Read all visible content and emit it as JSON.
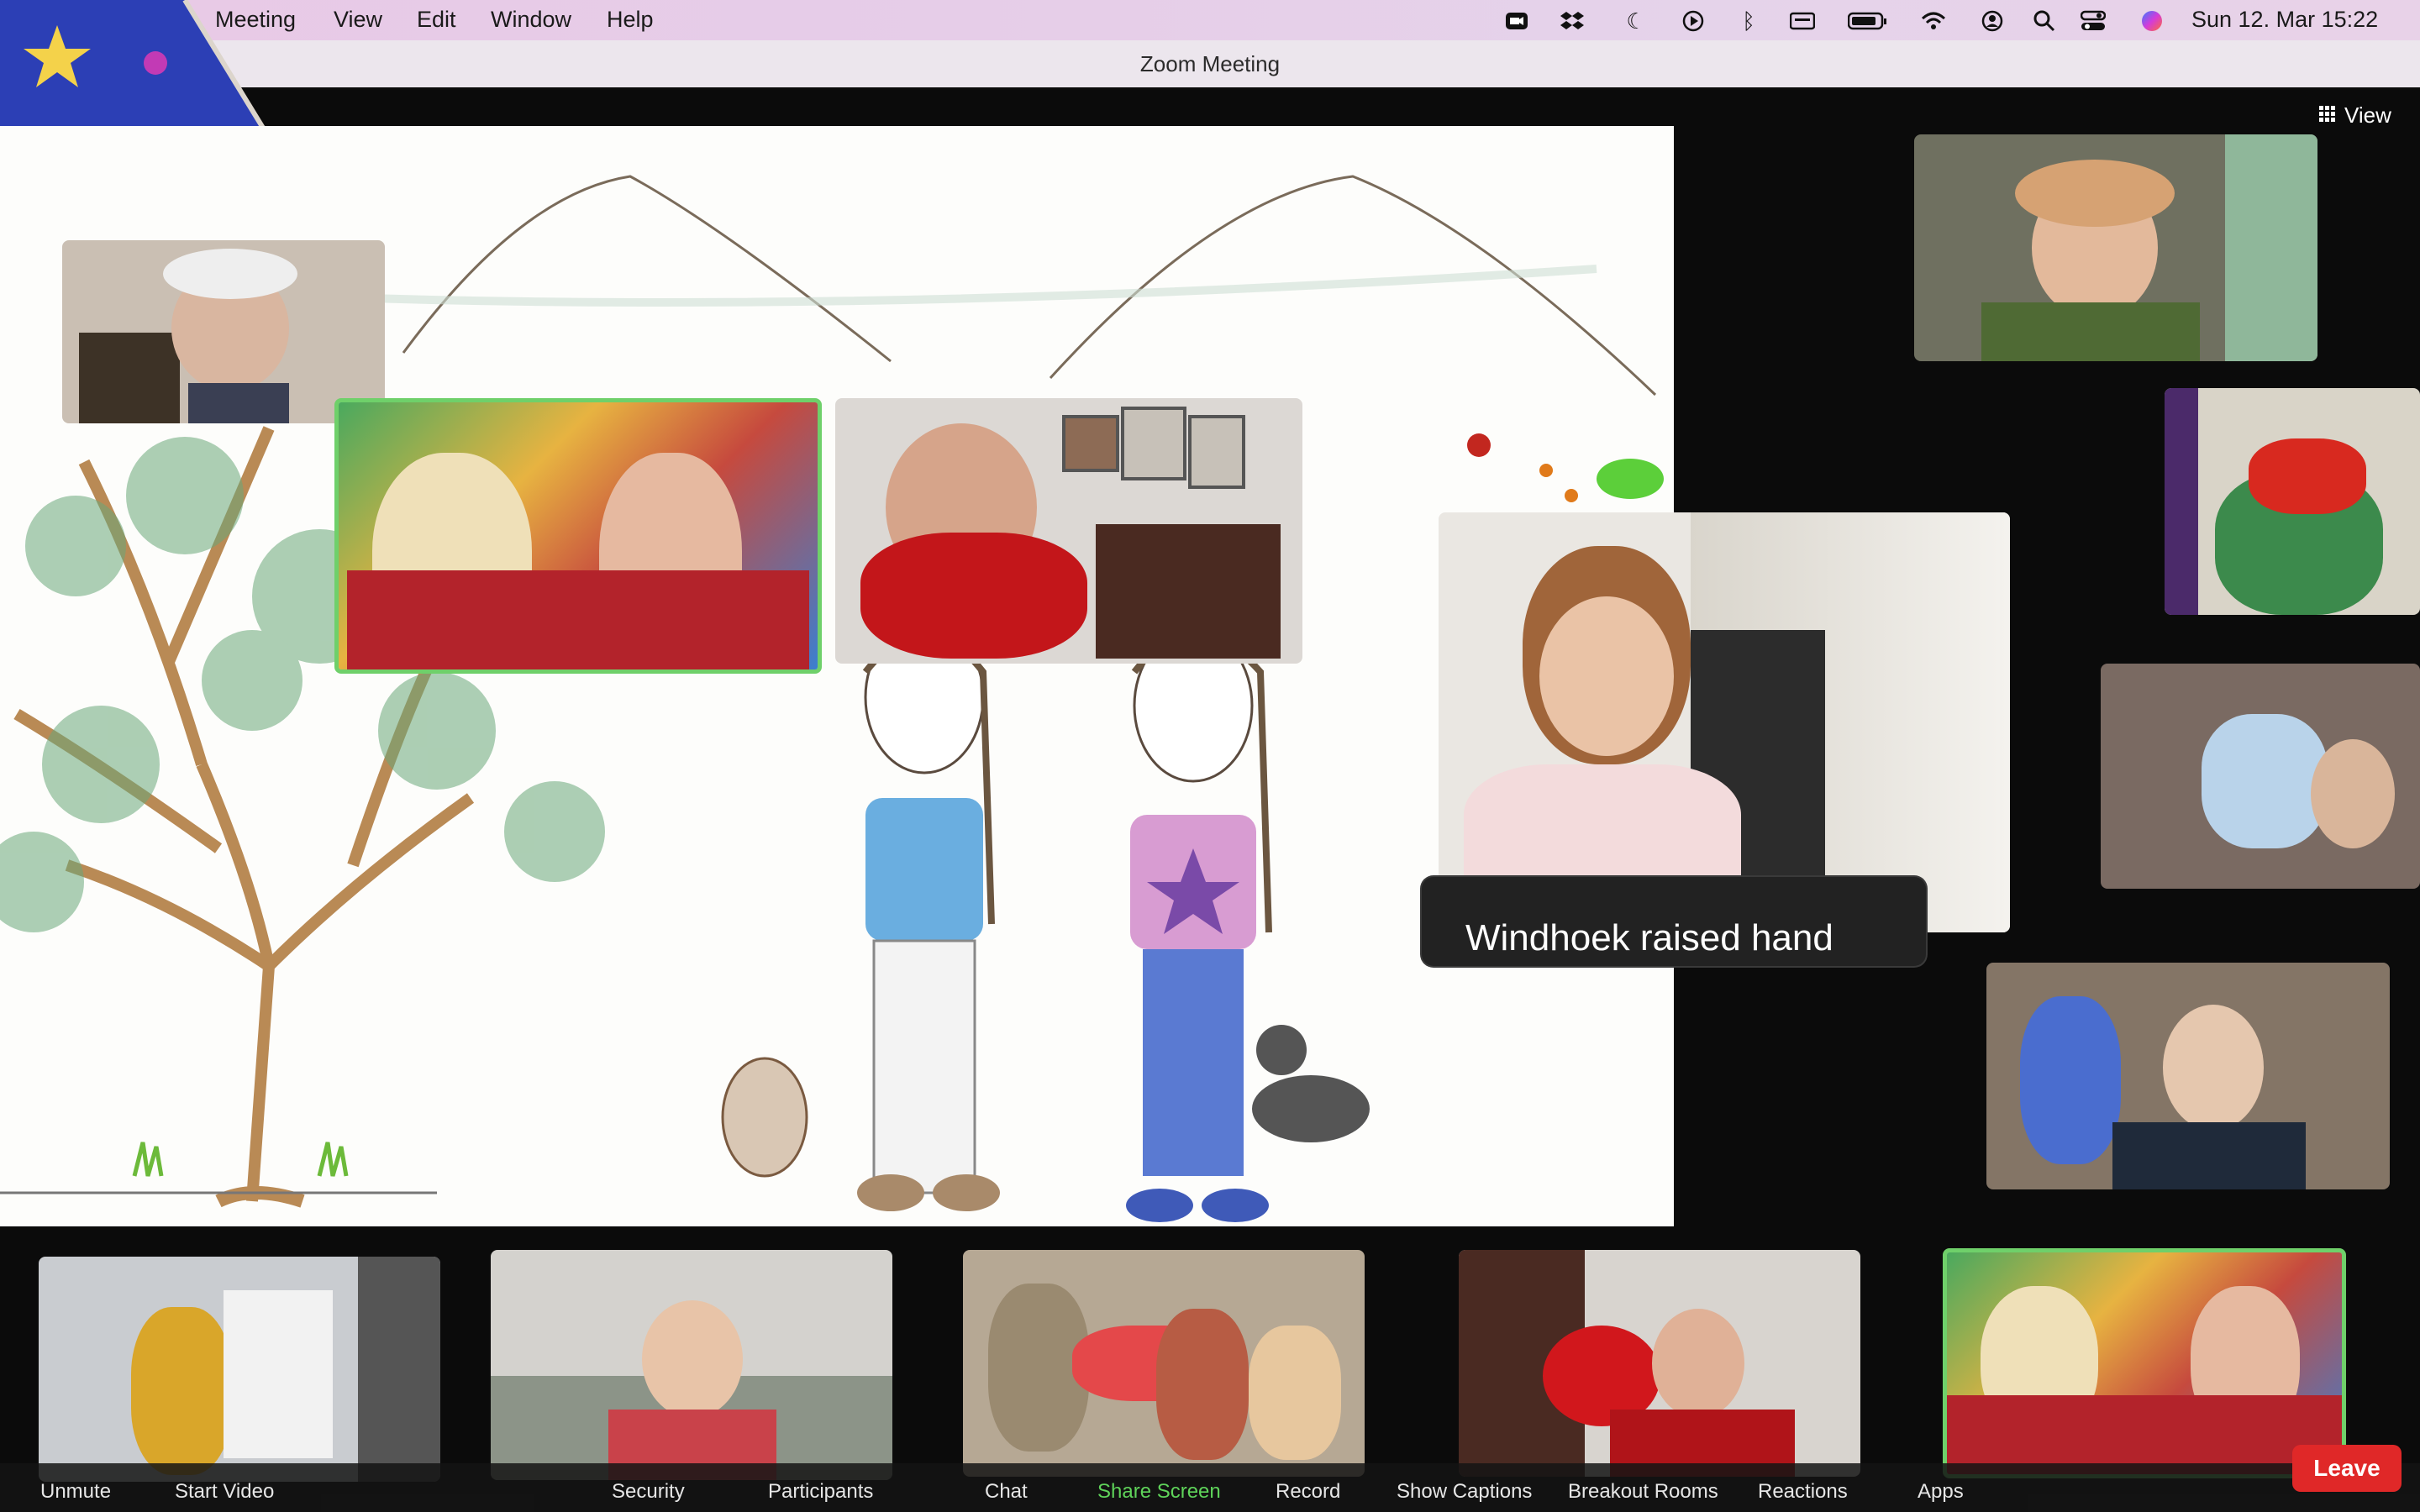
{
  "menubar": {
    "items": [
      "Meeting",
      "View",
      "Edit",
      "Window",
      "Help"
    ],
    "icons": [
      "zoom-icon",
      "dropbox-icon",
      "moon-icon",
      "play-icon",
      "bluetooth-icon",
      "keyboard-icon",
      "battery-icon",
      "wifi-icon",
      "user-icon",
      "search-icon",
      "control-center-icon",
      "siri-icon"
    ],
    "clock": "Sun 12. Mar  15:22"
  },
  "window": {
    "title": "Zoom Meeting"
  },
  "view_button": {
    "label": "View"
  },
  "notification": {
    "text": "Windhoek raised hand"
  },
  "toolbar": {
    "unmute": "Unmute",
    "start_video": "Start Video",
    "security": "Security",
    "participants": "Participants",
    "chat": "Chat",
    "share_screen": "Share Screen",
    "record": "Record",
    "show_captions": "Show Captions",
    "breakout_rooms": "Breakout Rooms",
    "reactions": "Reactions",
    "apps": "Apps",
    "leave": "Leave"
  },
  "colors": {
    "accent_green": "#6fd06a",
    "leave_red": "#e02828",
    "share_green": "#5fd35a"
  }
}
